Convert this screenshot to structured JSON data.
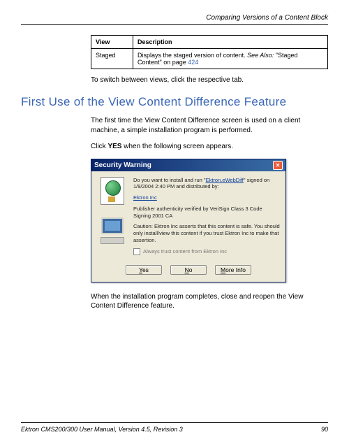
{
  "header": {
    "title": "Comparing Versions of a Content Block"
  },
  "table": {
    "col1": "View",
    "col2": "Description",
    "row_view": "Staged",
    "row_desc_a": "Displays the staged version of content. ",
    "row_desc_b": "See Also:",
    "row_desc_c": " \"Staged Content\" on page ",
    "row_desc_link": "424"
  },
  "switch_text": "To switch between views, click the respective tab.",
  "section_title": "First Use of the View Content Difference Feature",
  "para1": "The first time the View Content Difference screen is used on a client machine, a simple installation program is performed.",
  "para2a": "Click ",
  "para2b": "YES",
  "para2c": " when the following screen appears.",
  "dialog": {
    "title": "Security Warning",
    "line1a": "Do you want to install and run \"",
    "line1_link": "Ektron.eWebDiff",
    "line1b": "\" signed on 1/9/2004 2:40 PM and distributed by:",
    "publisher_link": "Ektron Inc",
    "line2": "Publisher authenticity verified by VeriSign Class 3 Code Signing 2001 CA",
    "line3": "Caution: Ektron Inc asserts that this content is safe. You should only install/view this content if you trust Ektron Inc to make that assertion.",
    "checkbox": "Always trust content from Ektron Inc",
    "btn_yes": "Yes",
    "btn_no": "No",
    "btn_more": "More Info"
  },
  "para3": "When the installation program completes, close and reopen the View Content Difference feature.",
  "footer": {
    "left": "Ektron CMS200/300 User Manual, Version 4.5, Revision 3",
    "right": "90"
  }
}
